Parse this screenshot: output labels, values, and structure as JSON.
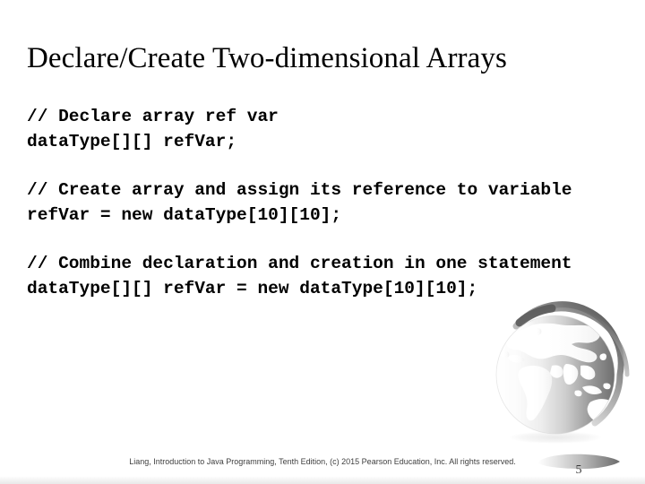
{
  "slide": {
    "title": "Declare/Create Two-dimensional Arrays",
    "page_number": "5",
    "background_color": "#ffffff",
    "text_color": "#000000"
  },
  "code_blocks": [
    {
      "comment": "// Declare array ref var",
      "statement": "dataType[][] refVar;"
    },
    {
      "comment": "// Create array and assign its reference to variable",
      "statement": "refVar = new dataType[10][10];"
    },
    {
      "comment": "// Combine declaration and creation in one statement",
      "statement": "dataType[][] refVar = new dataType[10][10];"
    }
  ],
  "footer": {
    "credit": "Liang, Introduction to Java Programming, Tenth Edition, (c) 2015 Pearson Education, Inc. All rights reserved."
  },
  "decor": {
    "globe_label": "globe-watermark",
    "globe_color_dark": "#6e6e6e",
    "globe_color_light": "#fcfcfc",
    "plate_color": "#808080"
  }
}
